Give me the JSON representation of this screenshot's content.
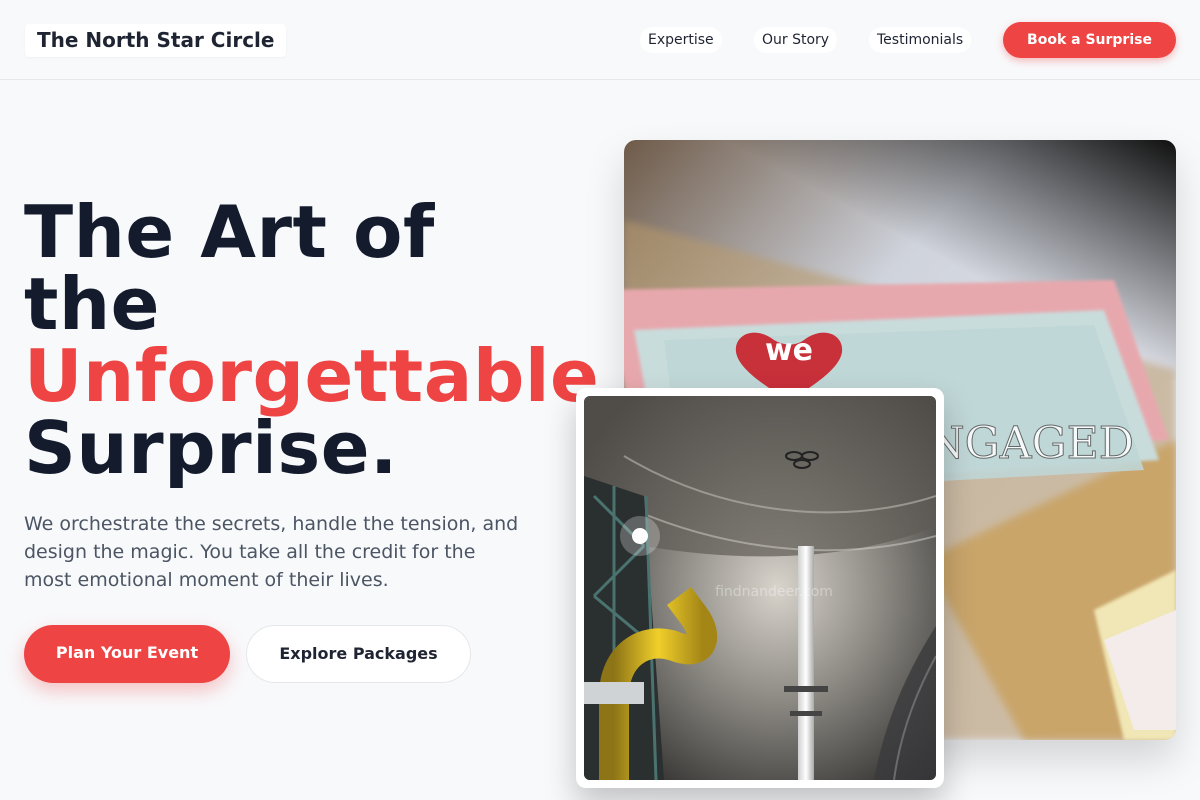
{
  "header": {
    "brand": "The North Star Circle",
    "nav": [
      {
        "label": "Expertise"
      },
      {
        "label": "Our Story"
      },
      {
        "label": "Testimonials"
      }
    ],
    "cta_label": "Book a Surprise"
  },
  "hero": {
    "title_line1": "The Art of",
    "title_line2": "the",
    "title_accent": "Unforgettable",
    "title_line4": "Surprise.",
    "subtitle": "We orchestrate the secrets, handle the tension, and design the magic. You take all the credit for the most emotional moment of their lives.",
    "primary_cta": "Plan Your Event",
    "secondary_cta": "Explore Packages"
  },
  "images": {
    "main": {
      "card_text_heart": "we",
      "card_text_word": "ENGAGED"
    },
    "inset": {
      "watermark": "findnandeer.com"
    }
  },
  "colors": {
    "accent": "#ef4444",
    "heading": "#141b2d",
    "body_text": "#4b5563",
    "background": "#f8f9fb"
  }
}
